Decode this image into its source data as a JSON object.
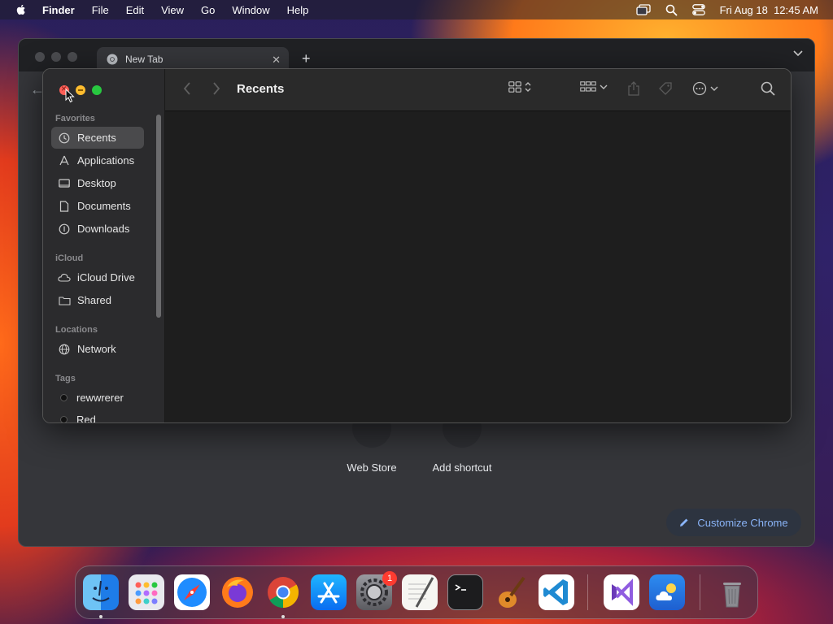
{
  "menubar": {
    "app_name": "Finder",
    "items": [
      "File",
      "Edit",
      "View",
      "Go",
      "Window",
      "Help"
    ],
    "clock": "Fri Aug 18  12:45 AM"
  },
  "chrome": {
    "tab_title": "New Tab",
    "shortcuts": [
      {
        "label": "Web Store"
      },
      {
        "label": "Add shortcut"
      }
    ],
    "customize_label": "Customize Chrome"
  },
  "finder": {
    "title": "Recents",
    "sections": {
      "favorites": "Favorites",
      "icloud": "iCloud",
      "locations": "Locations",
      "tags": "Tags"
    },
    "favorites": [
      "Recents",
      "Applications",
      "Desktop",
      "Documents",
      "Downloads"
    ],
    "icloud": [
      "iCloud Drive",
      "Shared"
    ],
    "locations": [
      "Network"
    ],
    "tags": [
      "rewwrerer",
      "Red"
    ]
  },
  "dock": {
    "apps": [
      "Finder",
      "Launchpad",
      "Safari",
      "Firefox",
      "Google Chrome",
      "App Store",
      "System Settings",
      "TextEdit",
      "Terminal",
      "GarageBand",
      "Visual Studio Code",
      "Visual Studio",
      "Weather",
      "Trash"
    ],
    "settings_badge": "1"
  },
  "colors": {
    "accent_blue": "#8ab4f8",
    "close_red": "#fe5f57",
    "minimize_yellow": "#febc2e",
    "zoom_green": "#28c840"
  }
}
